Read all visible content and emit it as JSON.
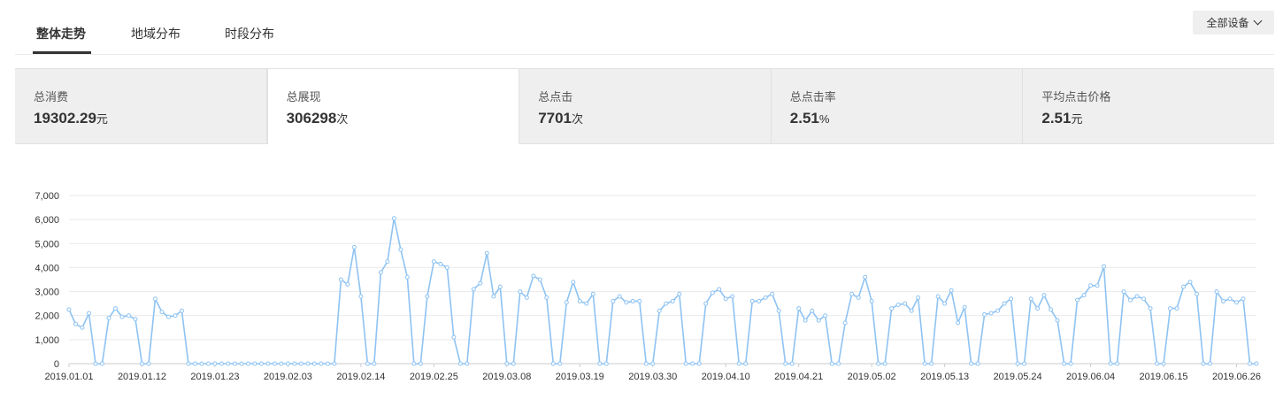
{
  "tabs": [
    {
      "label": "整体走势",
      "active": true
    },
    {
      "label": "地域分布",
      "active": false
    },
    {
      "label": "时段分布",
      "active": false
    }
  ],
  "device_select": {
    "label": "全部设备"
  },
  "metrics": [
    {
      "label": "总消费",
      "value": "19302.29",
      "unit": "元",
      "active": false
    },
    {
      "label": "总展现",
      "value": "306298",
      "unit": "次",
      "active": true
    },
    {
      "label": "总点击",
      "value": "7701",
      "unit": "次",
      "active": false
    },
    {
      "label": "总点击率",
      "value": "2.51",
      "unit": "%",
      "active": false
    },
    {
      "label": "平均点击价格",
      "value": "2.51",
      "unit": "元",
      "active": false
    }
  ],
  "colors": {
    "line": "#8ec3f2",
    "grid": "#e9e9e9",
    "axis": "#cccccc"
  },
  "chart_data": {
    "type": "line",
    "y_ticks": [
      "7,000",
      "6,000",
      "5,000",
      "4,000",
      "3,000",
      "2,000",
      "1,000",
      "0"
    ],
    "ylim": [
      0,
      7000
    ],
    "x_tick_labels": [
      "2019.01.01",
      "2019.01.12",
      "2019.01.23",
      "2019.02.03",
      "2019.02.14",
      "2019.02.25",
      "2019.03.08",
      "2019.03.19",
      "2019.03.30",
      "2019.04.10",
      "2019.04.21",
      "2019.05.02",
      "2019.05.13",
      "2019.05.24",
      "2019.06.04",
      "2019.06.15",
      "2019.06.26"
    ],
    "x_start": "2019.01.01",
    "x_end": "2019.06.30",
    "series": [
      {
        "values": [
          2250,
          1650,
          1500,
          2100,
          0,
          0,
          1900,
          2300,
          1950,
          2000,
          1850,
          0,
          0,
          2700,
          2150,
          1950,
          2000,
          2200,
          0,
          0,
          0,
          0,
          0,
          0,
          0,
          0,
          0,
          0,
          0,
          0,
          0,
          0,
          0,
          0,
          0,
          0,
          0,
          0,
          0,
          0,
          0,
          3500,
          3300,
          4850,
          2800,
          0,
          0,
          3800,
          4250,
          6050,
          4750,
          3600,
          0,
          0,
          2800,
          4250,
          4150,
          4000,
          1100,
          0,
          0,
          3100,
          3350,
          4600,
          2800,
          3200,
          0,
          0,
          3000,
          2750,
          3650,
          3500,
          2750,
          0,
          0,
          2550,
          3400,
          2600,
          2500,
          2900,
          0,
          0,
          2600,
          2800,
          2550,
          2600,
          2600,
          0,
          0,
          2200,
          2500,
          2600,
          2900,
          0,
          0,
          0,
          2500,
          2950,
          3100,
          2700,
          2800,
          0,
          0,
          2600,
          2600,
          2750,
          2900,
          2200,
          0,
          0,
          2300,
          1800,
          2200,
          1800,
          2000,
          0,
          0,
          1700,
          2900,
          2750,
          3600,
          2600,
          0,
          0,
          2300,
          2450,
          2500,
          2200,
          2750,
          0,
          0,
          2800,
          2500,
          3050,
          1700,
          2350,
          0,
          0,
          2050,
          2100,
          2200,
          2500,
          2700,
          0,
          0,
          2700,
          2300,
          2850,
          2250,
          1800,
          0,
          0,
          2650,
          2850,
          3250,
          3250,
          4050,
          0,
          0,
          3000,
          2650,
          2800,
          2700,
          2300,
          0,
          0,
          2300,
          2300,
          3200,
          3400,
          2900,
          0,
          0,
          3000,
          2600,
          2700,
          2550,
          2700,
          0,
          0
        ]
      }
    ],
    "grid": true,
    "legend": "none"
  }
}
